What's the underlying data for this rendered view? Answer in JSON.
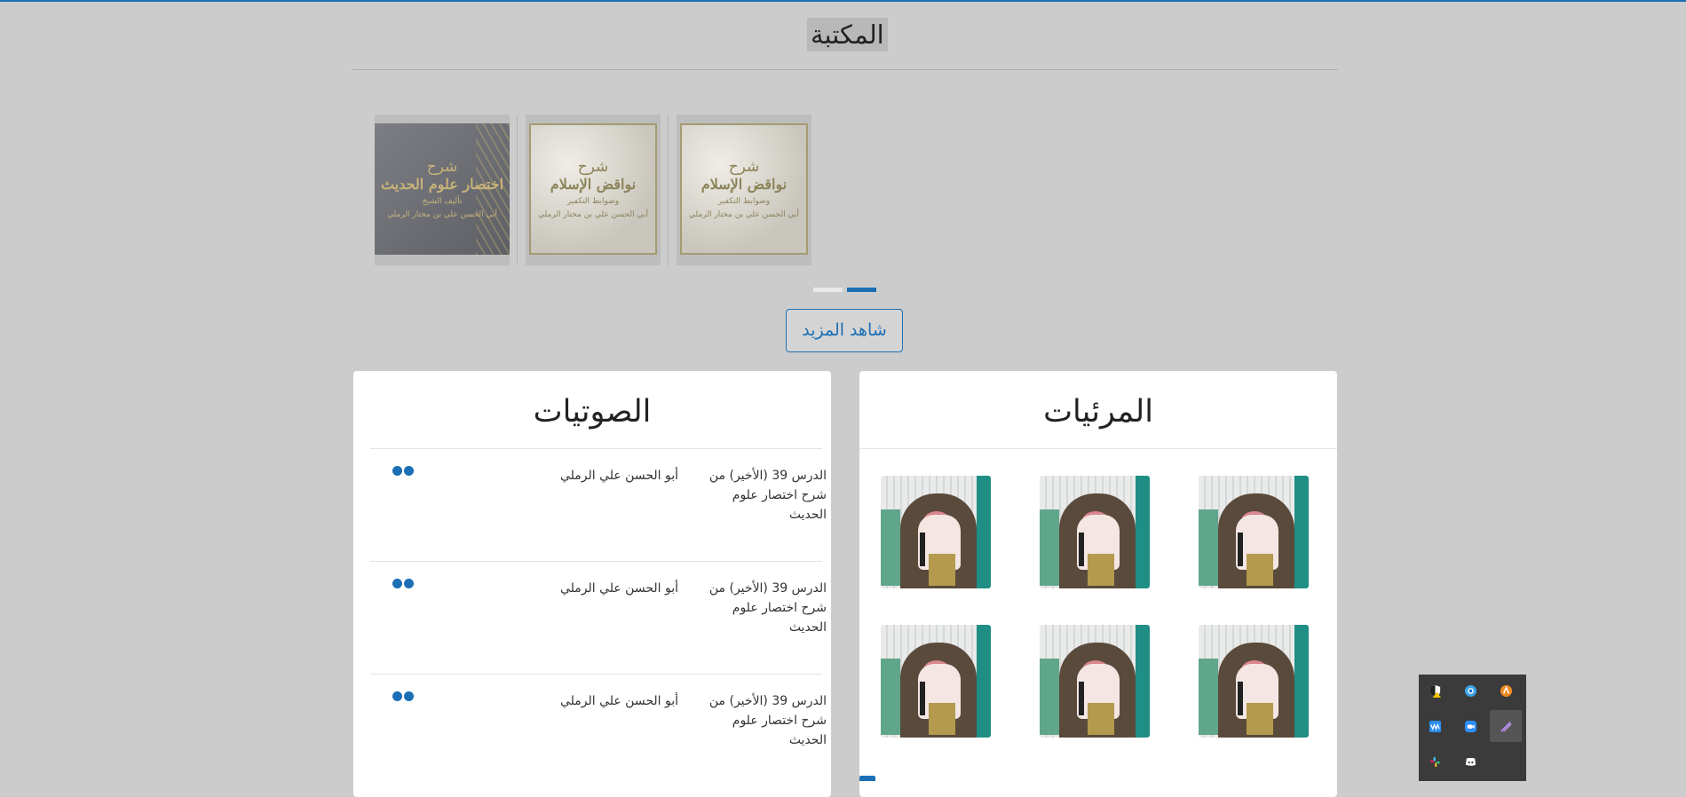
{
  "library": {
    "title": "المكتبة",
    "books": [
      {
        "line1": "شرح",
        "line2": "نواقض الإسلام",
        "line3": "وضوابط التكفير",
        "line4": "أبي الحسن علي بن مختار الرملي"
      },
      {
        "line1": "شرح",
        "line2": "نواقض الإسلام",
        "line3": "وضوابط التكفير",
        "line4": "أبي الحسن علي بن مختار الرملي"
      },
      {
        "line1": "شرح",
        "line2": "اختصار علوم الحديث",
        "line3": "تأليف الشيخ",
        "line4": "أبي الحسن علي بن مختار الرملي"
      }
    ],
    "carousel_pages": 2,
    "active_page": 2,
    "more_label": "شاهد المزيد"
  },
  "audio": {
    "title": "الصوتيات",
    "items": [
      {
        "title": "الدرس 39 (الأخير) من شرح اختصار علوم الحديث",
        "author": "أبو الحسن علي الرملي"
      },
      {
        "title": "الدرس 39 (الأخير) من شرح اختصار علوم الحديث",
        "author": "أبو الحسن علي الرملي"
      },
      {
        "title": "الدرس 39 (الأخير) من شرح اختصار علوم الحديث",
        "author": "أبو الحسن علي الرملي"
      }
    ]
  },
  "video": {
    "title": "المرئيات",
    "thumbnail_count": 6
  },
  "tray": {
    "icons": [
      "security-warning-icon",
      "browser-icon",
      "orange-app-icon",
      "audio-app-icon",
      "zoom-icon",
      "pen-icon",
      "slack-icon",
      "discord-icon"
    ],
    "colors": {
      "accent": "#1b6fb5",
      "background": "#cccccc"
    }
  }
}
